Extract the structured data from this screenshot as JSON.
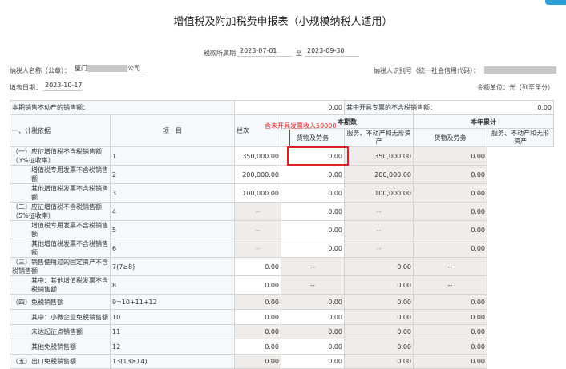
{
  "title": "增值税及附加税费申报表（小规模纳税人适用）",
  "period": {
    "label": "税款所属期",
    "from": "2023-07-01",
    "sep": "至",
    "to": "2023-09-30"
  },
  "taxpayer": {
    "name_label": "纳税人名称（公章）：",
    "name_prefix": "厦门",
    "name_suffix": "公司",
    "id_label": "纳税人识别号（统一社会信用代码）："
  },
  "fill_date": {
    "label": "填表日期：",
    "value": "2023-10-17"
  },
  "unit": "金额单位：元（列至角分）",
  "top_row": {
    "label1": "本期销售不动产的销售额：",
    "value1": "0.00",
    "label2": "其中开具专票的不含税销售额：",
    "value2": "0.00"
  },
  "section": "一、计税依据",
  "headers": {
    "item": "项　目",
    "col": "栏次",
    "current": "本期数",
    "ytd": "本年累计",
    "goods": "货物及劳务",
    "services": "服务、不动产和无形资产",
    "services_ytd": "服务、不动产和无形资产"
  },
  "annotation": "含未开具发票收入50000",
  "rows": [
    {
      "item": "（一）应征增值税不含税销售额（3%征收率）",
      "col": "1",
      "v": [
        "350,000.00",
        "0.00",
        "350,000.00",
        "0.00"
      ]
    },
    {
      "item": "增值税专用发票不含税销售额",
      "col": "2",
      "v": [
        "200,000.00",
        "0.00",
        "200,000.00",
        "0.00"
      ]
    },
    {
      "item": "其他增值税发票不含税销售额",
      "col": "3",
      "v": [
        "100,000.00",
        "0.00",
        "100,000.00",
        "0.00"
      ]
    },
    {
      "item": "（二）应征增值税不含税销售额（5%征收率）",
      "col": "4",
      "v": [
        "--",
        "0.00",
        "--",
        "0.00"
      ]
    },
    {
      "item": "增值税专用发票不含税销售额",
      "col": "5",
      "v": [
        "--",
        "0.00",
        "--",
        "0.00"
      ]
    },
    {
      "item": "其他增值税发票不含税销售额",
      "col": "6",
      "v": [
        "--",
        "0.00",
        "--",
        "0.00"
      ]
    },
    {
      "item": "（三）销售使用过的固定资产不含税销售额",
      "col": "7(7≥8)",
      "v": [
        "0.00",
        "--",
        "0.00",
        "--"
      ]
    },
    {
      "item": "其中：其他增值税发票不含税销售额",
      "col": "8",
      "v": [
        "0.00",
        "--",
        "0.00",
        "--"
      ]
    },
    {
      "item": "（四）免税销售额",
      "col": "9=10+11+12",
      "v": [
        "0.00",
        "0.00",
        "0.00",
        "0.00"
      ]
    },
    {
      "item": "其中：小微企业免税销售额",
      "col": "10",
      "v": [
        "0.00",
        "0.00",
        "0.00",
        "0.00"
      ]
    },
    {
      "item": "未达起征点销售额",
      "col": "11",
      "v": [
        "0.00",
        "0.00",
        "0.00",
        "0.00"
      ]
    },
    {
      "item": "其他免税销售额",
      "col": "12",
      "v": [
        "0.00",
        "0.00",
        "0.00",
        "0.00"
      ]
    },
    {
      "item": "（五）出口免税销售额",
      "col": "13(13≥14)",
      "v": [
        "0.00",
        "0.00",
        "0.00",
        "0.00"
      ]
    }
  ]
}
